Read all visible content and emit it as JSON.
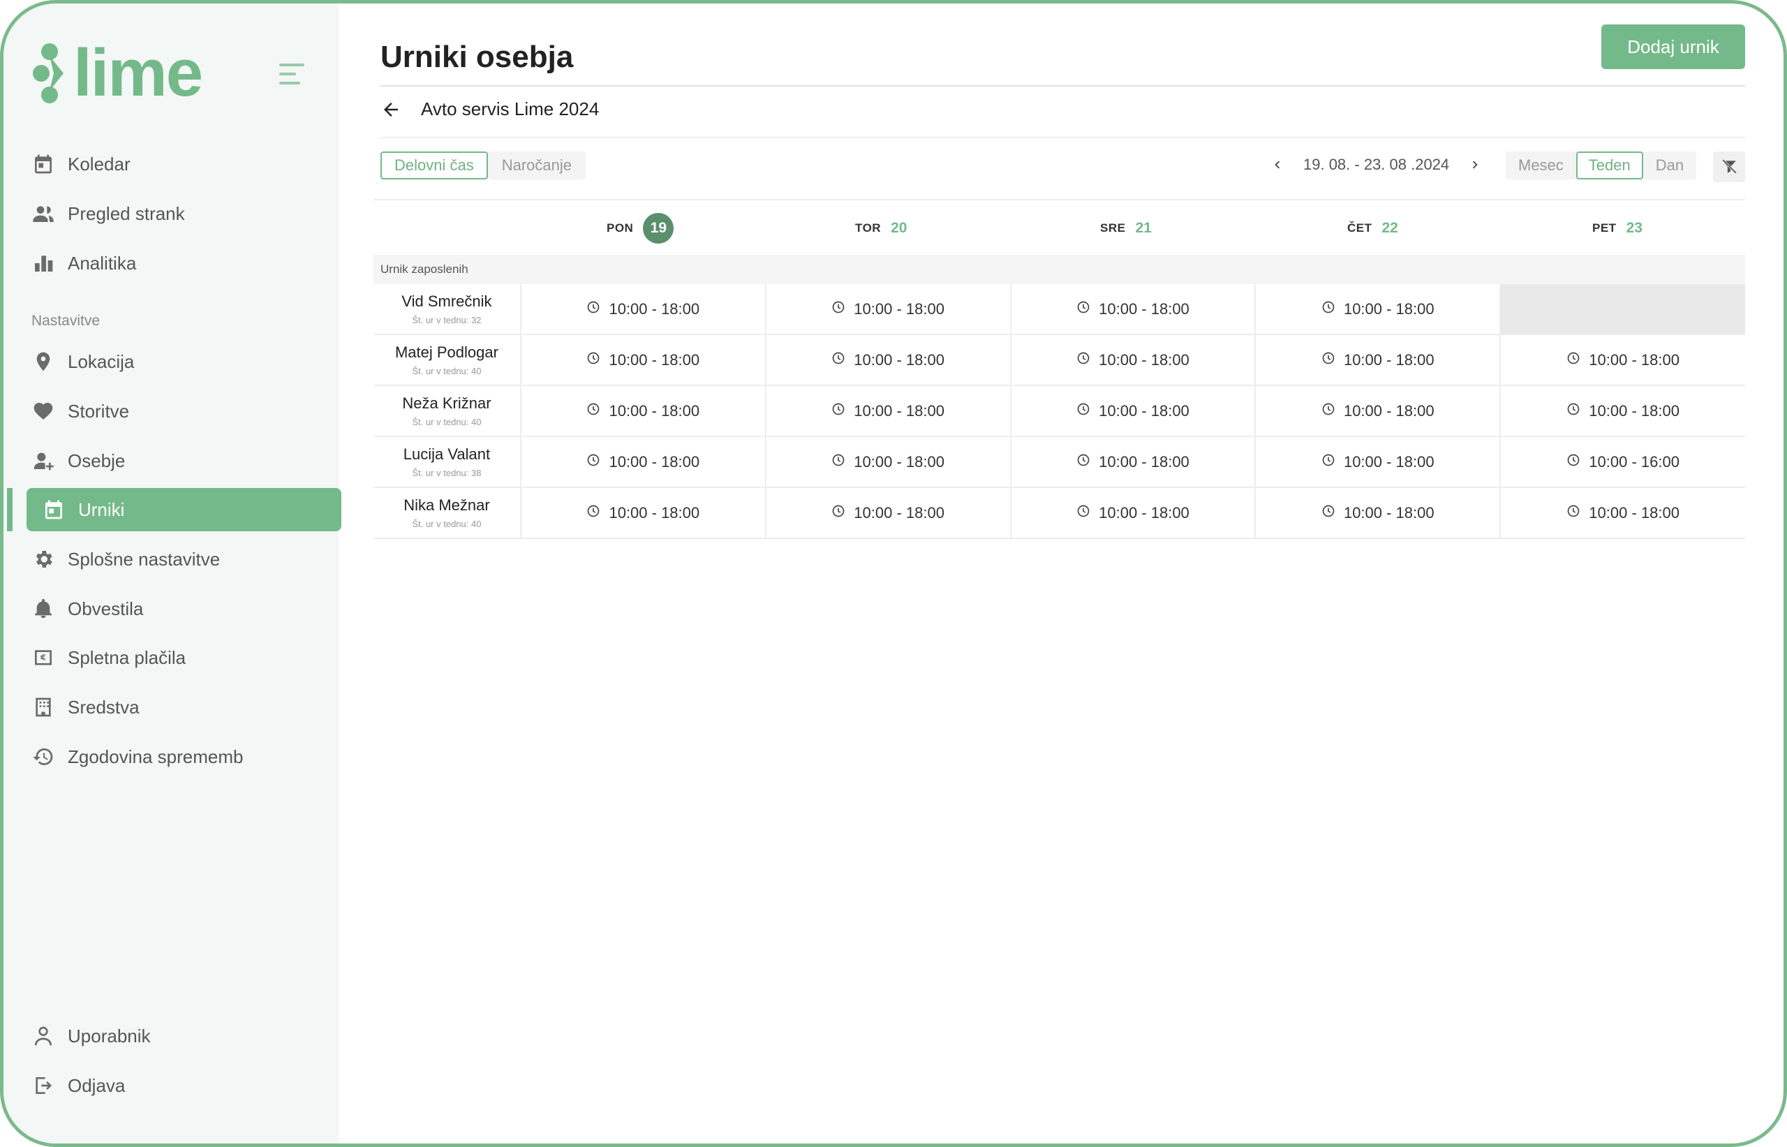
{
  "brand": {
    "name": "lime",
    "color": "#74b98a"
  },
  "sidebar": {
    "items": [
      {
        "label": "Koledar",
        "icon": "calendar-icon"
      },
      {
        "label": "Pregled strank",
        "icon": "users-icon"
      },
      {
        "label": "Analitika",
        "icon": "bar-chart-icon"
      }
    ],
    "settings_label": "Nastavitve",
    "settings_items": [
      {
        "label": "Lokacija",
        "icon": "location-pin-icon"
      },
      {
        "label": "Storitve",
        "icon": "heart-hand-icon"
      },
      {
        "label": "Osebje",
        "icon": "user-add-icon"
      },
      {
        "label": "Urniki",
        "icon": "calendar-icon",
        "active": true
      },
      {
        "label": "Splošne nastavitve",
        "icon": "gear-icon"
      },
      {
        "label": "Obvestila",
        "icon": "bell-icon"
      },
      {
        "label": "Spletna plačila",
        "icon": "euro-card-icon"
      },
      {
        "label": "Sredstva",
        "icon": "building-icon"
      },
      {
        "label": "Zgodovina sprememb",
        "icon": "history-icon"
      }
    ],
    "bottom_items": [
      {
        "label": "Uporabnik",
        "icon": "user-icon"
      },
      {
        "label": "Odjava",
        "icon": "logout-icon"
      }
    ]
  },
  "header": {
    "title": "Urniki osebja",
    "add_button": "Dodaj urnik"
  },
  "location": {
    "name": "Avto servis Lime 2024"
  },
  "mode_toggle": {
    "options": [
      "Delovni čas",
      "Naročanje"
    ],
    "selected": "Delovni čas"
  },
  "date_range": "19. 08. - 23. 08 .2024",
  "view_toggle": {
    "options": [
      "Mesec",
      "Teden",
      "Dan"
    ],
    "selected": "Teden"
  },
  "schedule": {
    "days": [
      {
        "name": "PON",
        "date": "19",
        "today": true
      },
      {
        "name": "TOR",
        "date": "20"
      },
      {
        "name": "SRE",
        "date": "21"
      },
      {
        "name": "ČET",
        "date": "22"
      },
      {
        "name": "PET",
        "date": "23"
      }
    ],
    "group_label": "Urnik zaposlenih",
    "employees": [
      {
        "name": "Vid Smrečnik",
        "hours": "Št. ur v tednu: 32",
        "shifts": [
          "10:00 - 18:00",
          "10:00 - 18:00",
          "10:00 - 18:00",
          "10:00 - 18:00",
          ""
        ]
      },
      {
        "name": "Matej Podlogar",
        "hours": "Št. ur v tednu: 40",
        "shifts": [
          "10:00 - 18:00",
          "10:00 - 18:00",
          "10:00 - 18:00",
          "10:00 - 18:00",
          "10:00 - 18:00"
        ]
      },
      {
        "name": "Neža Križnar",
        "hours": "Št. ur v tednu: 40",
        "shifts": [
          "10:00 - 18:00",
          "10:00 - 18:00",
          "10:00 - 18:00",
          "10:00 - 18:00",
          "10:00 - 18:00"
        ]
      },
      {
        "name": "Lucija Valant",
        "hours": "Št. ur v tednu: 38",
        "shifts": [
          "10:00 - 18:00",
          "10:00 - 18:00",
          "10:00 - 18:00",
          "10:00 - 18:00",
          "10:00 - 16:00"
        ]
      },
      {
        "name": "Nika Mežnar",
        "hours": "Št. ur v tednu: 40",
        "shifts": [
          "10:00 - 18:00",
          "10:00 - 18:00",
          "10:00 - 18:00",
          "10:00 - 18:00",
          "10:00 - 18:00"
        ]
      }
    ]
  }
}
